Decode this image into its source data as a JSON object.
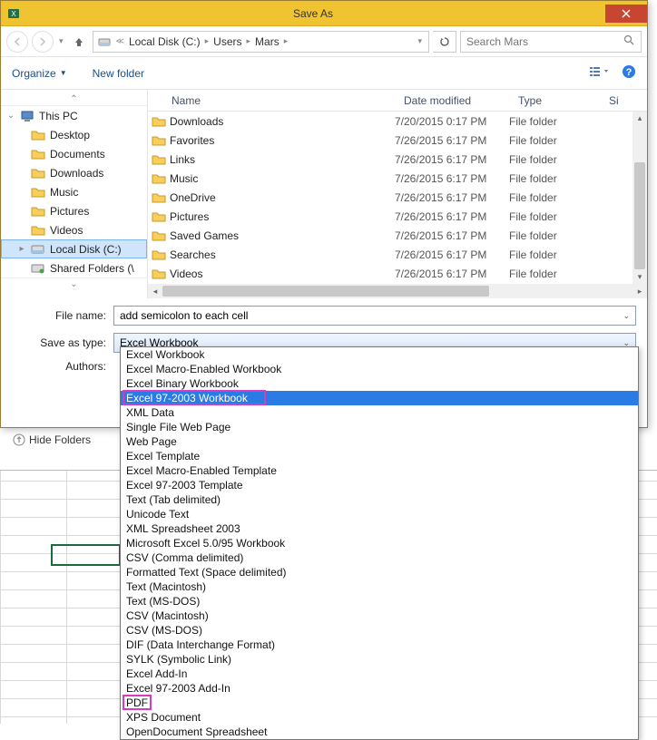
{
  "title": "Save As",
  "nav": {
    "address_parts": [
      "Local Disk (C:)",
      "Users",
      "Mars"
    ],
    "search_placeholder": "Search Mars"
  },
  "toolbar": {
    "organize": "Organize",
    "newfolder": "New folder"
  },
  "sidebar": {
    "root": "This PC",
    "items": [
      {
        "label": "Desktop"
      },
      {
        "label": "Documents"
      },
      {
        "label": "Downloads"
      },
      {
        "label": "Music"
      },
      {
        "label": "Pictures"
      },
      {
        "label": "Videos"
      },
      {
        "label": "Local Disk (C:)",
        "selected": true
      },
      {
        "label": "Shared Folders (\\"
      }
    ]
  },
  "columns": {
    "name": "Name",
    "date": "Date modified",
    "type": "Type",
    "size": "Si"
  },
  "files": [
    {
      "name": "Downloads",
      "date": "7/20/2015 0:17 PM",
      "type": "File folder"
    },
    {
      "name": "Favorites",
      "date": "7/26/2015 6:17 PM",
      "type": "File folder"
    },
    {
      "name": "Links",
      "date": "7/26/2015 6:17 PM",
      "type": "File folder"
    },
    {
      "name": "Music",
      "date": "7/26/2015 6:17 PM",
      "type": "File folder"
    },
    {
      "name": "OneDrive",
      "date": "7/26/2015 6:17 PM",
      "type": "File folder"
    },
    {
      "name": "Pictures",
      "date": "7/26/2015 6:17 PM",
      "type": "File folder"
    },
    {
      "name": "Saved Games",
      "date": "7/26/2015 6:17 PM",
      "type": "File folder"
    },
    {
      "name": "Searches",
      "date": "7/26/2015 6:17 PM",
      "type": "File folder"
    },
    {
      "name": "Videos",
      "date": "7/26/2015 6:17 PM",
      "type": "File folder"
    }
  ],
  "form": {
    "filename_label": "File name:",
    "filename_value": "add semicolon to each cell",
    "saveastype_label": "Save as type:",
    "saveastype_value": "Excel Workbook",
    "authors_label": "Authors:"
  },
  "hidefolders": "Hide Folders",
  "filetypes": [
    "Excel Workbook",
    "Excel Macro-Enabled Workbook",
    "Excel Binary Workbook",
    "Excel 97-2003 Workbook",
    "XML Data",
    "Single File Web Page",
    "Web Page",
    "Excel Template",
    "Excel Macro-Enabled Template",
    "Excel 97-2003 Template",
    "Text (Tab delimited)",
    "Unicode Text",
    "XML Spreadsheet 2003",
    "Microsoft Excel 5.0/95 Workbook",
    "CSV (Comma delimited)",
    "Formatted Text (Space delimited)",
    "Text (Macintosh)",
    "Text (MS-DOS)",
    "CSV (Macintosh)",
    "CSV (MS-DOS)",
    "DIF (Data Interchange Format)",
    "SYLK (Symbolic Link)",
    "Excel Add-In",
    "Excel 97-2003 Add-In",
    "PDF",
    "XPS Document",
    "OpenDocument Spreadsheet"
  ],
  "highlighted_type_index": 3,
  "annotated_indices": [
    3,
    24
  ]
}
